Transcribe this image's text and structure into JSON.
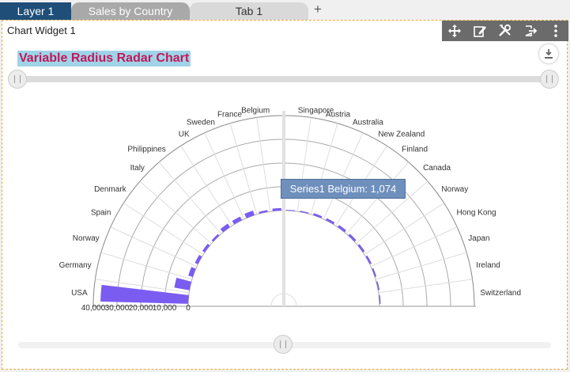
{
  "tabs": [
    {
      "label": "Layer 1"
    },
    {
      "label": "Sales by Country"
    },
    {
      "label": "Tab 1"
    }
  ],
  "add_tab_label": "+",
  "widget": {
    "title": "Chart Widget 1",
    "toolbar_icons": [
      "move-icon",
      "edit-icon",
      "tools-icon",
      "export-icon",
      "more-icon"
    ]
  },
  "colors": {
    "accent": "#1f4e79",
    "bar": "#7b5cf0",
    "title_text": "#c2185b",
    "title_bg": "#9fd4e8",
    "tooltip": "#6f8fbd"
  },
  "chart_data": {
    "type": "bar",
    "title": "Variable Radius Radar Chart",
    "categories": [
      "USA",
      "Germany",
      "Norway",
      "Spain",
      "Denmark",
      "Italy",
      "Philippines",
      "UK",
      "Sweden",
      "France",
      "Belgium",
      "Singapore",
      "Austria",
      "Australia",
      "New Zealand",
      "Finland",
      "Canada",
      "Norway",
      "Hong Kong",
      "Japan",
      "Ireland",
      "Switzerland"
    ],
    "series": [
      {
        "name": "Series1",
        "values": [
          37000,
          6500,
          2000,
          1400,
          1200,
          900,
          1800,
          1700,
          2000,
          800,
          1074,
          300,
          500,
          900,
          1000,
          1100,
          1000,
          950,
          850,
          700,
          600,
          500
        ]
      }
    ],
    "y_ticks": [
      "40,000",
      "30,000",
      "20,000",
      "10,000",
      "0"
    ],
    "ylim": [
      0,
      40000
    ]
  },
  "tooltip": {
    "text": "Series1 Belgium: 1,074"
  }
}
